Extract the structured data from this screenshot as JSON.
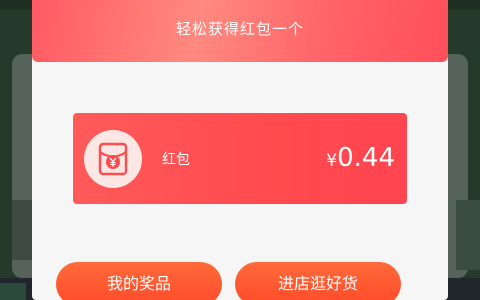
{
  "dialog": {
    "title": "轻松获得红包一个"
  },
  "packet": {
    "icon": "red-envelope-yen-icon",
    "label": "红包",
    "currency": "¥",
    "amount": "0.44"
  },
  "buttons": {
    "my_prizes": "我的奖品",
    "visit_shop": "进店逛好货"
  },
  "colors": {
    "header_gradient_start": "#ff5a63",
    "header_gradient_mid": "#ff8a7f",
    "packet_card": "#ff4a4e",
    "button": "#ff5530",
    "dialog_bg": "#f6f6f6",
    "overlay_bg": "#263a2c"
  }
}
